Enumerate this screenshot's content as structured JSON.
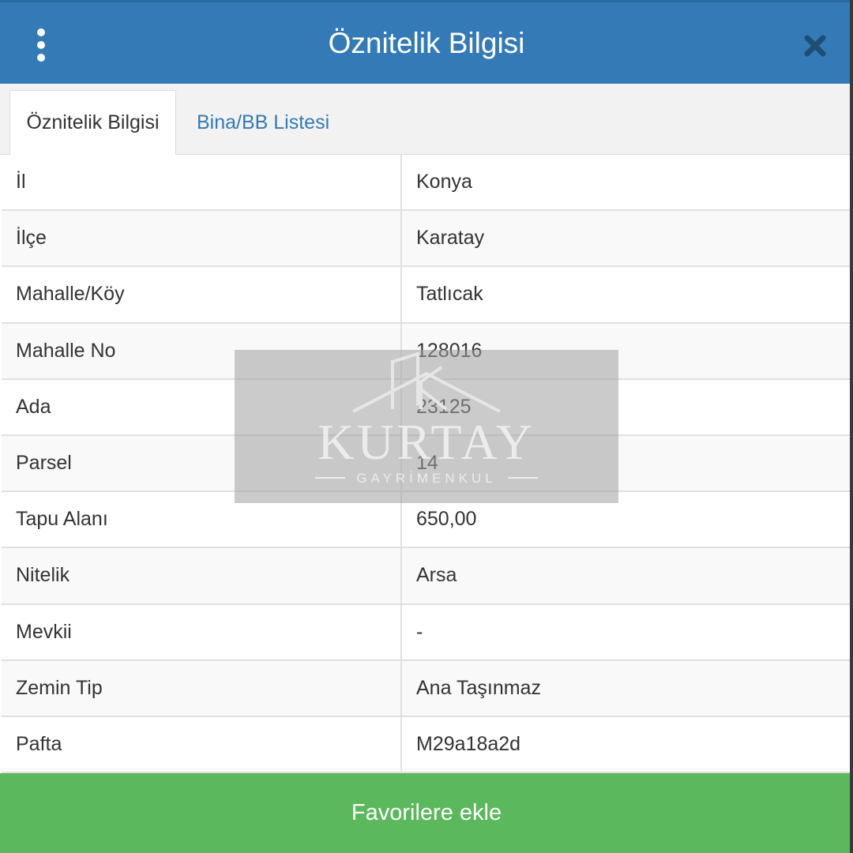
{
  "header": {
    "title": "Öznitelik Bilgisi",
    "menu_icon": "more-vertical-icon",
    "close_icon": "close-icon"
  },
  "tabs": [
    {
      "label": "Öznitelik Bilgisi",
      "active": true
    },
    {
      "label": "Bina/BB Listesi",
      "active": false
    }
  ],
  "attributes": [
    {
      "label": "İl",
      "value": "Konya"
    },
    {
      "label": "İlçe",
      "value": "Karatay"
    },
    {
      "label": "Mahalle/Köy",
      "value": "Tatlıcak"
    },
    {
      "label": "Mahalle No",
      "value": "128016"
    },
    {
      "label": "Ada",
      "value": "23125"
    },
    {
      "label": "Parsel",
      "value": "14"
    },
    {
      "label": "Tapu Alanı",
      "value": "650,00"
    },
    {
      "label": "Nitelik",
      "value": "Arsa"
    },
    {
      "label": "Mevkii",
      "value": "-"
    },
    {
      "label": "Zemin Tip",
      "value": "Ana Taşınmaz"
    },
    {
      "label": "Pafta",
      "value": "M29a18a2d"
    }
  ],
  "watermark": {
    "brand": "KURTAY",
    "subtitle": "GAYRİMENKUL"
  },
  "footer": {
    "favorite_label": "Favorilere ekle"
  },
  "colors": {
    "header_bg": "#337ab7",
    "tab_link": "#337ab7",
    "button_green": "#5cb85c"
  }
}
